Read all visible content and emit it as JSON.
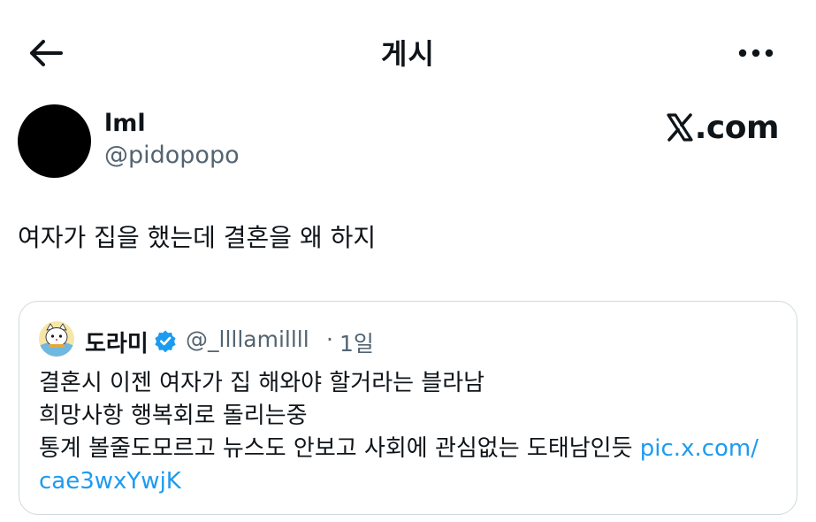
{
  "header": {
    "title": "게시",
    "back_icon": "arrow-left-icon",
    "more_icon": "more-horizontal-icon"
  },
  "post": {
    "author_name": "lml",
    "author_handle": "@pidopopo",
    "source_logo": "X.com",
    "source_logo_text": ".com",
    "text": "여자가 집을 했는데 결혼을 왜 하지"
  },
  "quote": {
    "author_name": "도라미",
    "verified_icon": "verified-badge-icon",
    "author_handle": "@_llllamillll",
    "separator": "·",
    "time": "1일",
    "lines": [
      "결혼시 이젠 여자가 집 해와야 할거라는 블라남",
      "희망사항 행복회로 돌리는중",
      "통계 볼줄도모르고 뉴스도 안보고 사회에 관심없는 도태남인듯 "
    ],
    "link_part1": "pic.x.com/",
    "link_part2": "cae3wxYwjK"
  },
  "colors": {
    "text": "#0f1419",
    "secondary": "#536471",
    "link": "#1d9bf0",
    "border": "#cfd9de",
    "verified": "#1d9bf0"
  }
}
